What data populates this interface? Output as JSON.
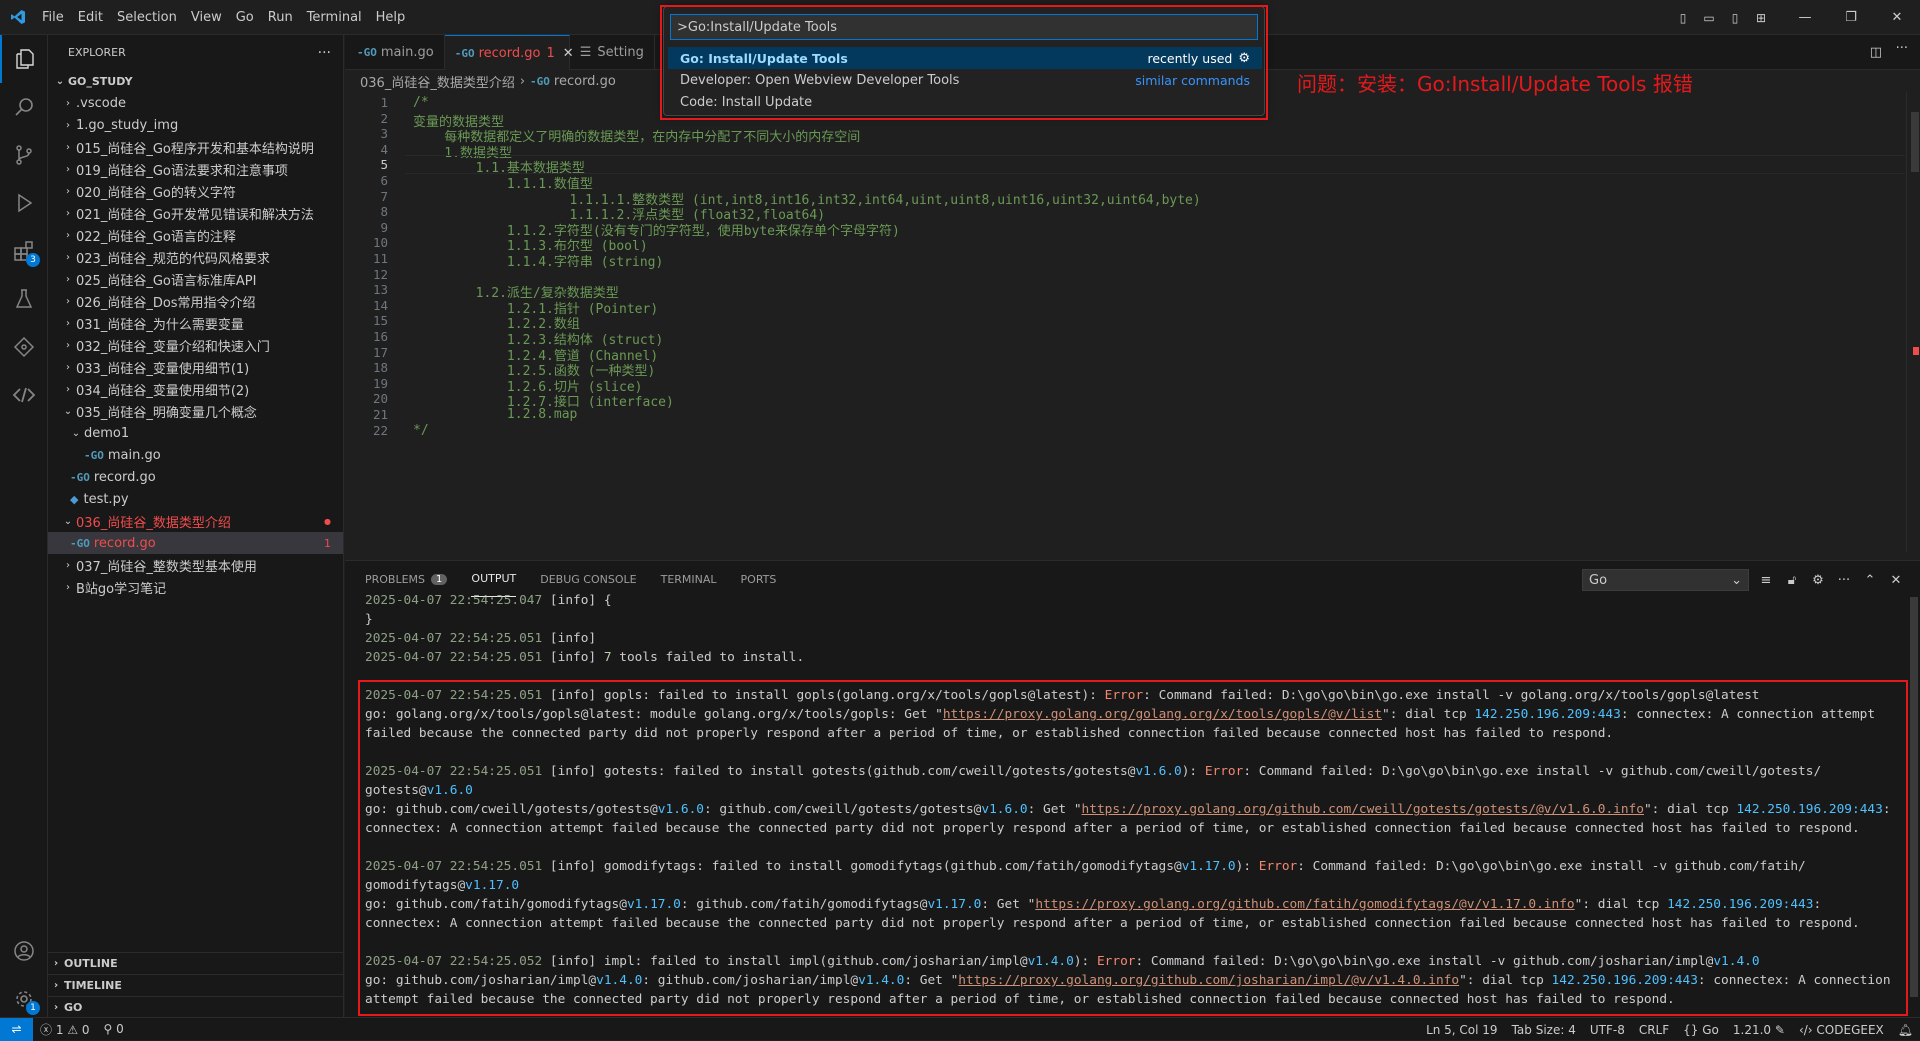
{
  "menu": [
    "File",
    "Edit",
    "Selection",
    "View",
    "Go",
    "Run",
    "Terminal",
    "Help"
  ],
  "sidebar": {
    "title": "EXPLORER",
    "root": "GO_STUDY",
    "items": [
      {
        "label": ".vscode",
        "type": "folder",
        "depth": 1,
        "state": "closed"
      },
      {
        "label": "1.go_study_img",
        "type": "folder",
        "depth": 1,
        "state": "closed"
      },
      {
        "label": "015_尚硅谷_Go程序开发和基本结构说明",
        "type": "folder",
        "depth": 1,
        "state": "closed"
      },
      {
        "label": "019_尚硅谷_Go语法要求和注意事项",
        "type": "folder",
        "depth": 1,
        "state": "closed"
      },
      {
        "label": "020_尚硅谷_Go的转义字符",
        "type": "folder",
        "depth": 1,
        "state": "closed"
      },
      {
        "label": "021_尚硅谷_Go开发常见错误和解决方法",
        "type": "folder",
        "depth": 1,
        "state": "closed"
      },
      {
        "label": "022_尚硅谷_Go语言的注释",
        "type": "folder",
        "depth": 1,
        "state": "closed"
      },
      {
        "label": "023_尚硅谷_规范的代码风格要求",
        "type": "folder",
        "depth": 1,
        "state": "closed"
      },
      {
        "label": "025_尚硅谷_Go语言标准库API",
        "type": "folder",
        "depth": 1,
        "state": "closed"
      },
      {
        "label": "026_尚硅谷_Dos常用指令介绍",
        "type": "folder",
        "depth": 1,
        "state": "closed"
      },
      {
        "label": "031_尚硅谷_为什么需要变量",
        "type": "folder",
        "depth": 1,
        "state": "closed"
      },
      {
        "label": "032_尚硅谷_变量介绍和快速入门",
        "type": "folder",
        "depth": 1,
        "state": "closed"
      },
      {
        "label": "033_尚硅谷_变量使用细节(1)",
        "type": "folder",
        "depth": 1,
        "state": "closed"
      },
      {
        "label": "034_尚硅谷_变量使用细节(2)",
        "type": "folder",
        "depth": 1,
        "state": "closed"
      },
      {
        "label": "035_尚硅谷_明确变量几个概念",
        "type": "folder",
        "depth": 1,
        "state": "open"
      },
      {
        "label": "demo1",
        "type": "folder",
        "depth": 2,
        "state": "open"
      },
      {
        "label": "main.go",
        "type": "go",
        "depth": 3
      },
      {
        "label": "record.go",
        "type": "go",
        "depth": 2
      },
      {
        "label": "test.py",
        "type": "py",
        "depth": 2
      },
      {
        "label": "036_尚硅谷_数据类型介绍",
        "type": "folder",
        "depth": 1,
        "state": "open",
        "error": true
      },
      {
        "label": "record.go",
        "type": "go",
        "depth": 2,
        "error": true,
        "selected": true,
        "count": "1"
      },
      {
        "label": "037_尚硅谷_整数类型基本使用",
        "type": "folder",
        "depth": 1,
        "state": "closed"
      },
      {
        "label": "B站go学习笔记",
        "type": "folder",
        "depth": 1,
        "state": "closed"
      }
    ],
    "sections": [
      "OUTLINE",
      "TIMELINE",
      "GO"
    ]
  },
  "tabs": [
    {
      "label": "main.go",
      "active": false
    },
    {
      "label": "record.go",
      "active": true,
      "count": "1"
    },
    {
      "label": "Setting",
      "active": false
    }
  ],
  "breadcrumb": {
    "folder": "036_尚硅谷_数据类型介绍",
    "file": "record.go"
  },
  "code": {
    "current_line": 5,
    "lines": [
      "/*",
      "变量的数据类型",
      "    每种数据都定义了明确的数据类型，在内存中分配了不同大小的内存空间",
      "    1.数据类型",
      "        1.1.基本数据类型",
      "            1.1.1.数值型",
      "                    1.1.1.1.整数类型 (int,int8,int16,int32,int64,uint,uint8,uint16,uint32,uint64,byte)",
      "                    1.1.1.2.浮点类型 (float32,float64)",
      "            1.1.2.字符型(没有专门的字符型，使用byte来保存单个字母字符)",
      "            1.1.3.布尔型 (bool)",
      "            1.1.4.字符串 (string)",
      "",
      "        1.2.派生/复杂数据类型",
      "            1.2.1.指针 (Pointer)",
      "            1.2.2.数组",
      "            1.2.3.结构体 (struct)",
      "            1.2.4.管道 (Channel)",
      "            1.2.5.函数 (一种类型)",
      "            1.2.6.切片 (slice)",
      "            1.2.7.接口 (interface)",
      "            1.2.8.map",
      "*/"
    ]
  },
  "palette": {
    "input_value": ">Go:Install/Update Tools",
    "items": [
      {
        "label": "Go: Install/Update Tools",
        "right": "recently used",
        "selected": true
      },
      {
        "label": "Developer: Open Webview Developer Tools",
        "right": "similar commands",
        "selected": false
      },
      {
        "label": "Code: Install Update",
        "right": "",
        "selected": false
      }
    ]
  },
  "annotation": "问题：安装：Go:Install/Update Tools 报错",
  "panel": {
    "tabs": [
      {
        "label": "PROBLEMS",
        "badge": "1"
      },
      {
        "label": "OUTPUT",
        "active": true
      },
      {
        "label": "DEBUG CONSOLE"
      },
      {
        "label": "TERMINAL"
      },
      {
        "label": "PORTS"
      }
    ],
    "channel": "Go"
  },
  "output": {
    "lines": [
      [
        {
          "t": "2025-04-07 22:54:25.047",
          "c": "ts"
        },
        {
          "t": " [info] {"
        }
      ],
      [
        {
          "t": "}"
        }
      ],
      [
        {
          "t": "2025-04-07 22:54:25.051",
          "c": "ts"
        },
        {
          "t": " [info]"
        }
      ],
      [
        {
          "t": "2025-04-07 22:54:25.051",
          "c": "ts"
        },
        {
          "t": " [info] "
        },
        {
          "t": "7",
          "c": "num"
        },
        {
          "t": " tools failed to install."
        }
      ],
      [],
      [
        {
          "t": "2025-04-07 22:54:25.051",
          "c": "ts"
        },
        {
          "t": " [info] gopls: failed to install gopls(golang.org/x/tools/gopls@latest): "
        },
        {
          "t": "Error",
          "c": "err"
        },
        {
          "t": ": Command failed: D:\\go\\go\\bin\\go.exe install -v golang.org/x/tools/gopls@latest"
        }
      ],
      [
        {
          "t": "go: golang.org/x/tools/gopls@latest: module golang.org/x/tools/gopls: Get \""
        },
        {
          "t": "https://proxy.golang.org/golang.org/x/tools/gopls/@v/list",
          "c": "url"
        },
        {
          "t": "\": dial tcp "
        },
        {
          "t": "142.250.196.209:443",
          "c": "ver"
        },
        {
          "t": ": connectex: A connection attempt"
        }
      ],
      [
        {
          "t": "failed because the connected party did not properly respond after a period of time, or established connection failed because connected host has failed to respond."
        }
      ],
      [],
      [
        {
          "t": "2025-04-07 22:54:25.051",
          "c": "ts"
        },
        {
          "t": " [info] gotests: failed to install gotests(github.com/cweill/gotests/gotests@"
        },
        {
          "t": "v1.6.0",
          "c": "ver"
        },
        {
          "t": "): "
        },
        {
          "t": "Error",
          "c": "err"
        },
        {
          "t": ": Command failed: D:\\go\\go\\bin\\go.exe install -v github.com/cweill/gotests/"
        }
      ],
      [
        {
          "t": "gotests@"
        },
        {
          "t": "v1.6.0",
          "c": "ver"
        }
      ],
      [
        {
          "t": "go: github.com/cweill/gotests/gotests@"
        },
        {
          "t": "v1.6.0",
          "c": "ver"
        },
        {
          "t": ": github.com/cweill/gotests/gotests@"
        },
        {
          "t": "v1.6.0",
          "c": "ver"
        },
        {
          "t": ": Get \""
        },
        {
          "t": "https://proxy.golang.org/github.com/cweill/gotests/gotests/@v/v1.6.0.info",
          "c": "url"
        },
        {
          "t": "\": dial tcp "
        },
        {
          "t": "142.250.196.209:443",
          "c": "ver"
        },
        {
          "t": ":"
        }
      ],
      [
        {
          "t": "connectex: A connection attempt failed because the connected party did not properly respond after a period of time, or established connection failed because connected host has failed to respond."
        }
      ],
      [],
      [
        {
          "t": "2025-04-07 22:54:25.051",
          "c": "ts"
        },
        {
          "t": " [info] gomodifytags: failed to install gomodifytags(github.com/fatih/gomodifytags@"
        },
        {
          "t": "v1.17.0",
          "c": "ver"
        },
        {
          "t": "): "
        },
        {
          "t": "Error",
          "c": "err"
        },
        {
          "t": ": Command failed: D:\\go\\go\\bin\\go.exe install -v github.com/fatih/"
        }
      ],
      [
        {
          "t": "gomodifytags@"
        },
        {
          "t": "v1.17.0",
          "c": "ver"
        }
      ],
      [
        {
          "t": "go: github.com/fatih/gomodifytags@"
        },
        {
          "t": "v1.17.0",
          "c": "ver"
        },
        {
          "t": ": github.com/fatih/gomodifytags@"
        },
        {
          "t": "v1.17.0",
          "c": "ver"
        },
        {
          "t": ": Get \""
        },
        {
          "t": "https://proxy.golang.org/github.com/fatih/gomodifytags/@v/v1.17.0.info",
          "c": "url"
        },
        {
          "t": "\": dial tcp "
        },
        {
          "t": "142.250.196.209:443",
          "c": "ver"
        },
        {
          "t": ":"
        }
      ],
      [
        {
          "t": "connectex: A connection attempt failed because the connected party did not properly respond after a period of time, or established connection failed because connected host has failed to respond."
        }
      ],
      [],
      [
        {
          "t": "2025-04-07 22:54:25.052",
          "c": "ts"
        },
        {
          "t": " [info] impl: failed to install impl(github.com/josharian/impl@"
        },
        {
          "t": "v1.4.0",
          "c": "ver"
        },
        {
          "t": "): "
        },
        {
          "t": "Error",
          "c": "err"
        },
        {
          "t": ": Command failed: D:\\go\\go\\bin\\go.exe install -v github.com/josharian/impl@"
        },
        {
          "t": "v1.4.0",
          "c": "ver"
        }
      ],
      [
        {
          "t": "go: github.com/josharian/impl@"
        },
        {
          "t": "v1.4.0",
          "c": "ver"
        },
        {
          "t": ": github.com/josharian/impl@"
        },
        {
          "t": "v1.4.0",
          "c": "ver"
        },
        {
          "t": ": Get \""
        },
        {
          "t": "https://proxy.golang.org/github.com/josharian/impl/@v/v1.4.0.info",
          "c": "url"
        },
        {
          "t": "\": dial tcp "
        },
        {
          "t": "142.250.196.209:443",
          "c": "ver"
        },
        {
          "t": ": connectex: A connection"
        }
      ],
      [
        {
          "t": "attempt failed because the connected party did not properly respond after a period of time, or established connection failed because connected host has failed to respond."
        }
      ]
    ]
  },
  "status": {
    "errors": "1",
    "warnings": "0",
    "ports": "0",
    "position": "Ln 5, Col 19",
    "tab_size": "Tab Size: 4",
    "encoding": "UTF-8",
    "eol": "CRLF",
    "language": "Go",
    "go_version": "1.21.0",
    "account": "CODEGEEX"
  },
  "activity_badges": {
    "extensions": "3",
    "settings": "1"
  },
  "colors": {
    "accent": "#0078d4",
    "annotation_red": "#e5191c",
    "error_file": "#f14c4c"
  }
}
